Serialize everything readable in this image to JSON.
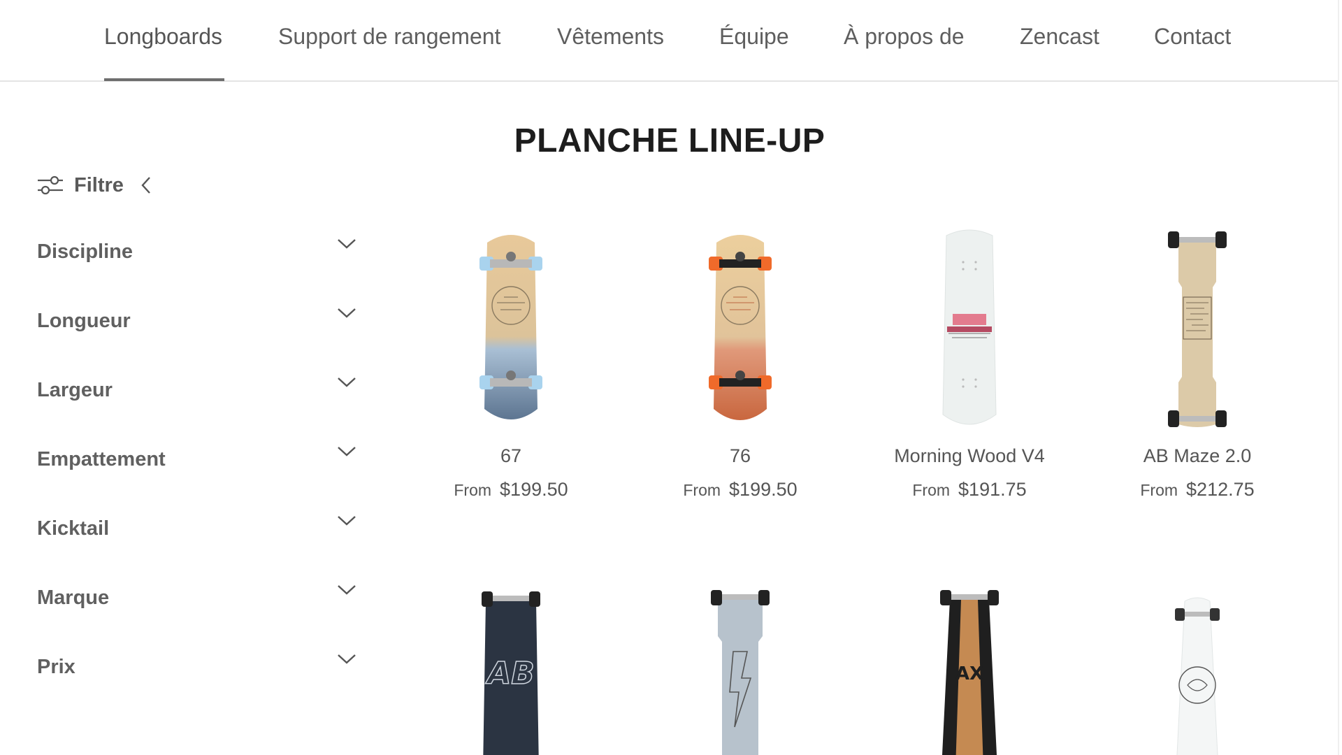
{
  "nav": {
    "items": [
      "Longboards",
      "Support de rangement",
      "Vêtements",
      "Équipe",
      "À propos de",
      "Zencast",
      "Contact"
    ],
    "active": "Longboards"
  },
  "page": {
    "title": "PLANCHE LINE-UP"
  },
  "filter": {
    "label": "Filtre",
    "facets": [
      "Discipline",
      "Longueur",
      "Largeur",
      "Empattement",
      "Kicktail",
      "Marque",
      "Prix"
    ]
  },
  "products": [
    {
      "name": "67",
      "from": "From",
      "price": "$199.50",
      "icon": "surfskate-deck-blue-wheels"
    },
    {
      "name": "76",
      "from": "From",
      "price": "$199.50",
      "icon": "surfskate-deck-orange-wheels"
    },
    {
      "name": "Morning Wood V4",
      "from": "From",
      "price": "$191.75",
      "icon": "white-longboard-deck"
    },
    {
      "name": "AB Maze 2.0",
      "from": "From",
      "price": "$212.75",
      "icon": "maze-drop-through-deck"
    }
  ],
  "products_row2": [
    {
      "icon": "black-ab-deck"
    },
    {
      "icon": "grey-lightning-deck"
    },
    {
      "icon": "ax-wood-deck"
    },
    {
      "icon": "white-pintail-deck"
    }
  ],
  "colors": {
    "text": "#4a4a4a",
    "title": "#1d1d1d",
    "divider": "#e4e4e4",
    "underline": "#6e6e6e"
  }
}
